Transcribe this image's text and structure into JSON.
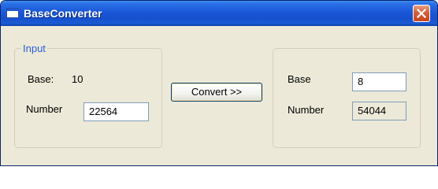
{
  "window": {
    "title": "BaseConverter"
  },
  "input_group": {
    "legend": "Input",
    "base_label": "Base:",
    "base_value": "10",
    "number_label": "Number",
    "number_value": "22564"
  },
  "convert_button": {
    "label": "Convert >>"
  },
  "output_group": {
    "base_label": "Base",
    "base_value": "8",
    "number_label": "Number",
    "number_value": "54044"
  },
  "colors": {
    "titlebar": "#1650CC",
    "window_bg": "#ECE9D8",
    "legend_text": "#2A5FD8",
    "close_button": "#C64520"
  }
}
